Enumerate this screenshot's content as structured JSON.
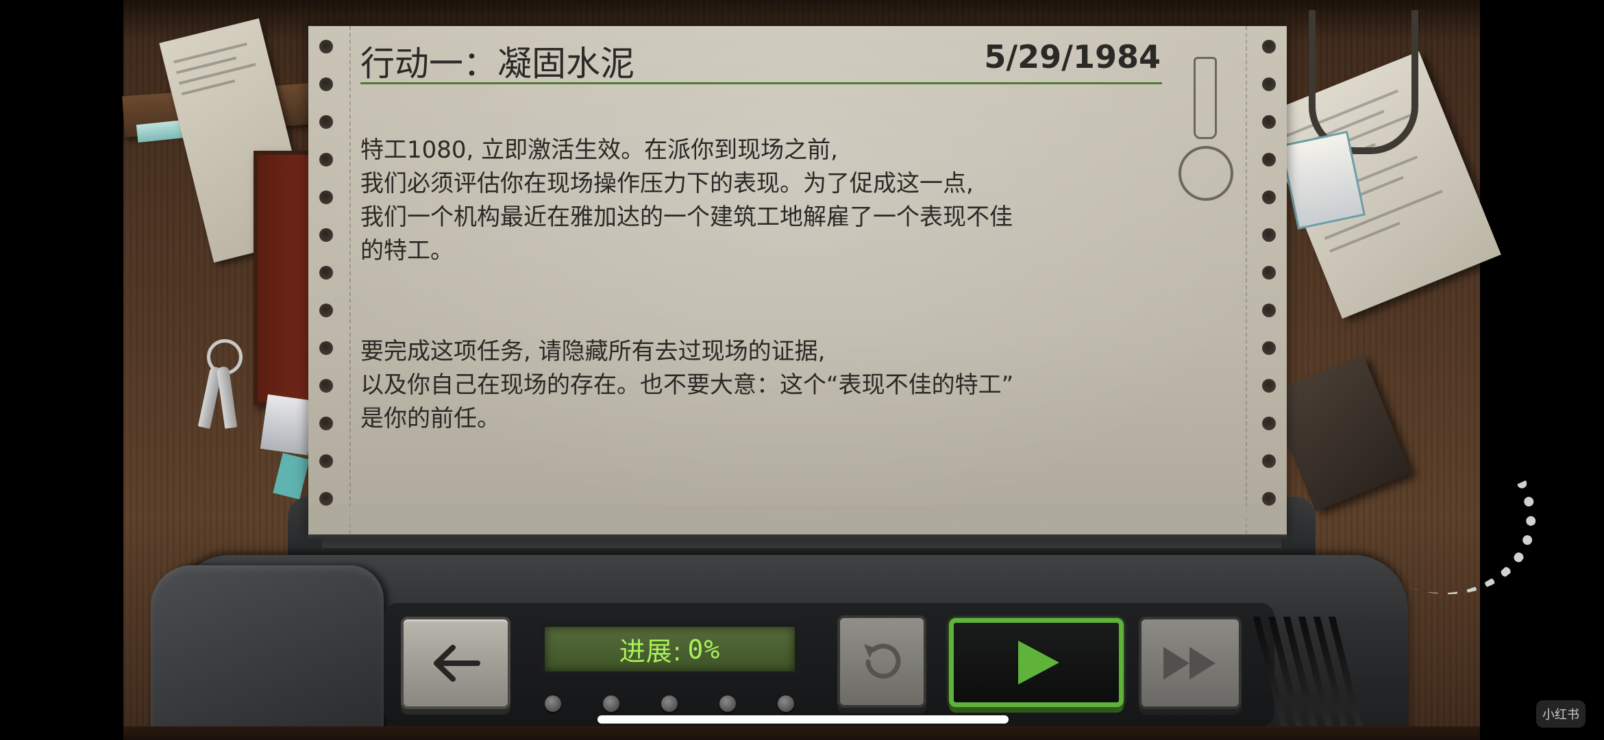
{
  "mission": {
    "title": "行动一：凝固水泥",
    "date": "5/29/1984",
    "paragraph1": "特工1080, 立即激活生效。在派你到现场之前,\n我们必须评估你在现场操作压力下的表现。为了促成这一点,\n我们一个机构最近在雅加达的一个建筑工地解雇了一个表现不佳\n的特工。",
    "paragraph2": "要完成这项任务, 请隐藏所有去过现场的证据,\n以及你自己在现场的存在。也不要大意：这个“表现不佳的特工”\n是你的前任。"
  },
  "controls": {
    "progress_label": "进展:",
    "progress_value": "0%",
    "progress_fraction": 0,
    "back_icon": "arrow-left-icon",
    "undo_icon": "undo-icon",
    "play_icon": "play-icon",
    "fast_forward_icon": "fast-forward-icon"
  },
  "watermark": "小红书",
  "colors": {
    "accent_green": "#5fb23a",
    "lcd_text": "#a9f05a",
    "paper": "#c9c4b6"
  }
}
